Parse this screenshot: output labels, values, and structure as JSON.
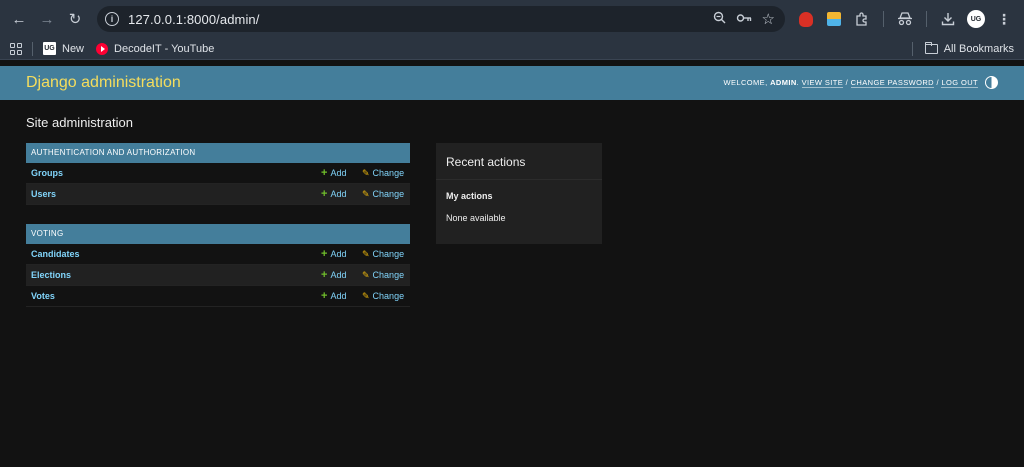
{
  "browser": {
    "url": "127.0.0.1:8000/admin/",
    "profile_initials": "UG",
    "bookmarks": [
      {
        "label": "New",
        "favicon": "UG"
      },
      {
        "label": "DecodeIT - YouTube",
        "favicon": "youtube-icon"
      }
    ],
    "all_bookmarks_label": "All Bookmarks"
  },
  "header": {
    "branding": "Django administration",
    "welcome": "Welcome, ",
    "user": "admin",
    "view_site": "View site",
    "change_password": "Change password",
    "log_out": "Log out",
    "separator": " / "
  },
  "main": {
    "title": "Site administration",
    "add_label": "Add",
    "change_label": "Change",
    "apps": [
      {
        "caption": "Authentication and Authorization",
        "models": [
          "Groups",
          "Users"
        ]
      },
      {
        "caption": "Voting",
        "models": [
          "Candidates",
          "Elections",
          "Votes"
        ]
      }
    ]
  },
  "recent": {
    "title": "Recent actions",
    "subtitle": "My actions",
    "empty": "None available"
  },
  "colors": {
    "header_bg": "#447e9b",
    "branding": "#f5dd5d",
    "link": "#81d4fa",
    "add_icon": "#70bf2b",
    "change_icon": "#efb80b",
    "page_bg": "#121212"
  }
}
